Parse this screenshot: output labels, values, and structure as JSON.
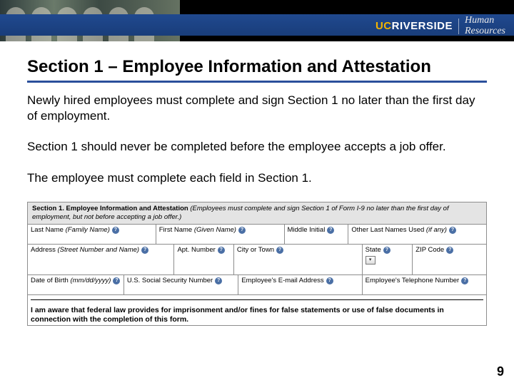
{
  "banner": {
    "brand_uc": "UC",
    "brand_riverside": "RIVERSIDE",
    "department": "Human\nResources"
  },
  "title": "Section 1 – Employee Information and Attestation",
  "paragraphs": {
    "p1": "Newly hired employees must complete and sign Section 1 no later than the first day of employment.",
    "p2": "Section 1 should never be completed before the employee accepts a job offer.",
    "p3": "The employee must complete each field in Section 1."
  },
  "form": {
    "header_strong": "Section 1. Employee Information and Attestation",
    "header_italic": "(Employees must complete and sign Section 1 of Form I-9 no later than the first day of employment, but not before accepting a job offer.)",
    "row1": {
      "last_name": "Last Name",
      "last_name_hint": "(Family Name)",
      "first_name": "First Name",
      "first_name_hint": "(Given Name)",
      "middle_initial": "Middle Initial",
      "other_last": "Other Last Names Used",
      "other_last_hint": "(if any)"
    },
    "row2": {
      "address": "Address",
      "address_hint": "(Street Number and Name)",
      "apt": "Apt. Number",
      "city": "City or Town",
      "state": "State",
      "zip": "ZIP Code"
    },
    "row3": {
      "dob": "Date of Birth",
      "dob_hint": "(mm/dd/yyyy)",
      "ssn": "U.S. Social Security Number",
      "email": "Employee's E-mail Address",
      "phone": "Employee's Telephone Number"
    },
    "attestation": "I am aware that federal law provides for imprisonment and/or fines for false statements or use of false documents in connection with the completion of this form."
  },
  "page_number": "9"
}
